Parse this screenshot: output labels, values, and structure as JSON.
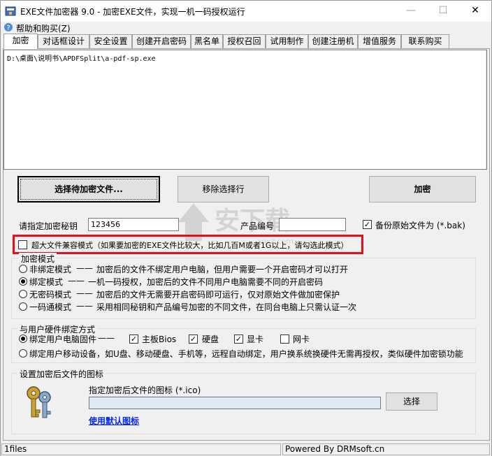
{
  "window": {
    "title": "EXE文件加密器 9.0 - 加密EXE文件，实现一机一码授权运行",
    "controls": {
      "minimize": "—",
      "maximize": "☐",
      "close": "✕"
    }
  },
  "menu": {
    "help": "帮助和购买(Z)"
  },
  "tabs": [
    "加密",
    "对话框设计",
    "安全设置",
    "创建开启密码",
    "黑名单",
    "授权召回",
    "试用制作",
    "创建注册机",
    "增值服务",
    "联系购买"
  ],
  "file_list": [
    "D:\\桌面\\说明书\\APDFSplit\\a-pdf-sp.exe"
  ],
  "buttons": {
    "select_file": "选择待加密文件...",
    "remove_selected": "移除选择行",
    "encrypt": "加密",
    "choose_icon": "选择"
  },
  "key": {
    "label": "请指定加密秘钥",
    "value": "123456"
  },
  "product": {
    "label": "产品编号",
    "value": ""
  },
  "backup": {
    "label": "备份原始文件为 (*.bak)",
    "checked": true
  },
  "large_file": {
    "label": "超大文件兼容模式（如果要加密的EXE文件比较大，比如几百M或者1G以上，请勾选此模式）",
    "checked": false
  },
  "encrypt_mode": {
    "title": "加密模式",
    "options": [
      {
        "label": "非绑定模式",
        "desc": "加密后的文件不绑定用户电脑，但用户需要一个开启密码才可以打开",
        "selected": false
      },
      {
        "label": "绑定模式",
        "desc": "一机一码授权，加密后的文件不同用户电脑需要不同的开启密码",
        "selected": true
      },
      {
        "label": "无密码模式",
        "desc": "加密后的文件无需要开启密码即可运行，仅对原始文件做加密保护",
        "selected": false
      },
      {
        "label": "一码通模式",
        "desc": "采用相同秘钥和产品编号加密的不同文件，在同台电脑上只需认证一次",
        "selected": false
      }
    ]
  },
  "hardware": {
    "title": "与用户硬件绑定方式",
    "bind_pc_label": "绑定用户电脑固件",
    "bind_pc_selected": true,
    "items": [
      {
        "label": "主板Bios",
        "checked": true
      },
      {
        "label": "硬盘",
        "checked": true
      },
      {
        "label": "显卡",
        "checked": true
      },
      {
        "label": "网卡",
        "checked": false
      }
    ],
    "bind_usb_label": "绑定用户移动设备，如U盘、移动硬盘、手机等，远程自动绑定，用户换系统换硬件无需再授权，类似硬件加密锁功能",
    "bind_usb_selected": false
  },
  "icon_section": {
    "title": "设置加密后文件的图标",
    "label": "指定加密后文件的图标 (*.ico)",
    "path": "",
    "default_link": "使用默认图标"
  },
  "watermark": {
    "text": "安下载",
    "sub": "anxz.com"
  },
  "statusbar": {
    "left": "1files",
    "right": "Powered By DRMsoft.cn"
  },
  "colors": {
    "highlight_border": "#e3101b",
    "link": "#0026ff"
  }
}
